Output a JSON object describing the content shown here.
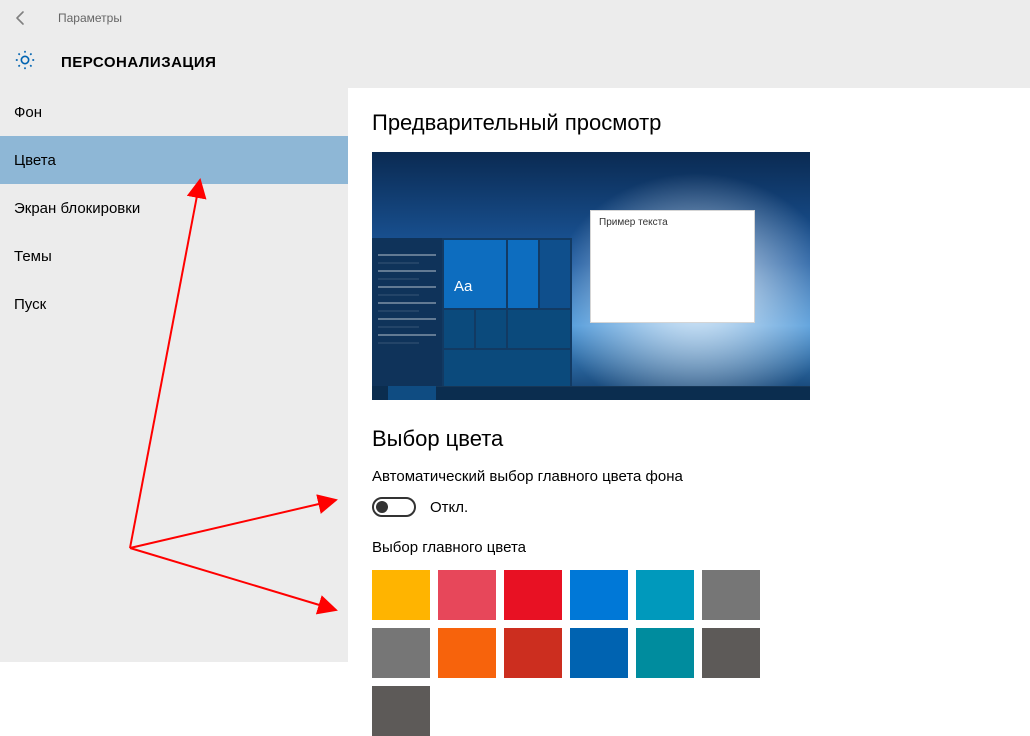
{
  "titlebar": {
    "app_title": "Параметры"
  },
  "category": {
    "title": "ПЕРСОНАЛИЗАЦИЯ"
  },
  "sidebar": {
    "items": [
      {
        "label": "Фон",
        "selected": false
      },
      {
        "label": "Цвета",
        "selected": true
      },
      {
        "label": "Экран блокировки",
        "selected": false
      },
      {
        "label": "Темы",
        "selected": false
      },
      {
        "label": "Пуск",
        "selected": false
      }
    ]
  },
  "content": {
    "preview_heading": "Предварительный просмотр",
    "sample_window_title": "Пример текста",
    "tile_text": "Aa",
    "color_section_heading": "Выбор цвета",
    "auto_pick_label": "Автоматический выбор главного цвета фона",
    "toggle_state": "Откл.",
    "accent_label": "Выбор главного цвета",
    "swatches": [
      "#ffb400",
      "#e7475a",
      "#e81123",
      "#0078d7",
      "#0099bc",
      "#767676",
      "#767676",
      "#f7630c",
      "#cc2e1f",
      "#0063b1",
      "#008c9e",
      "#5d5a58",
      "#5d5a58"
    ]
  }
}
